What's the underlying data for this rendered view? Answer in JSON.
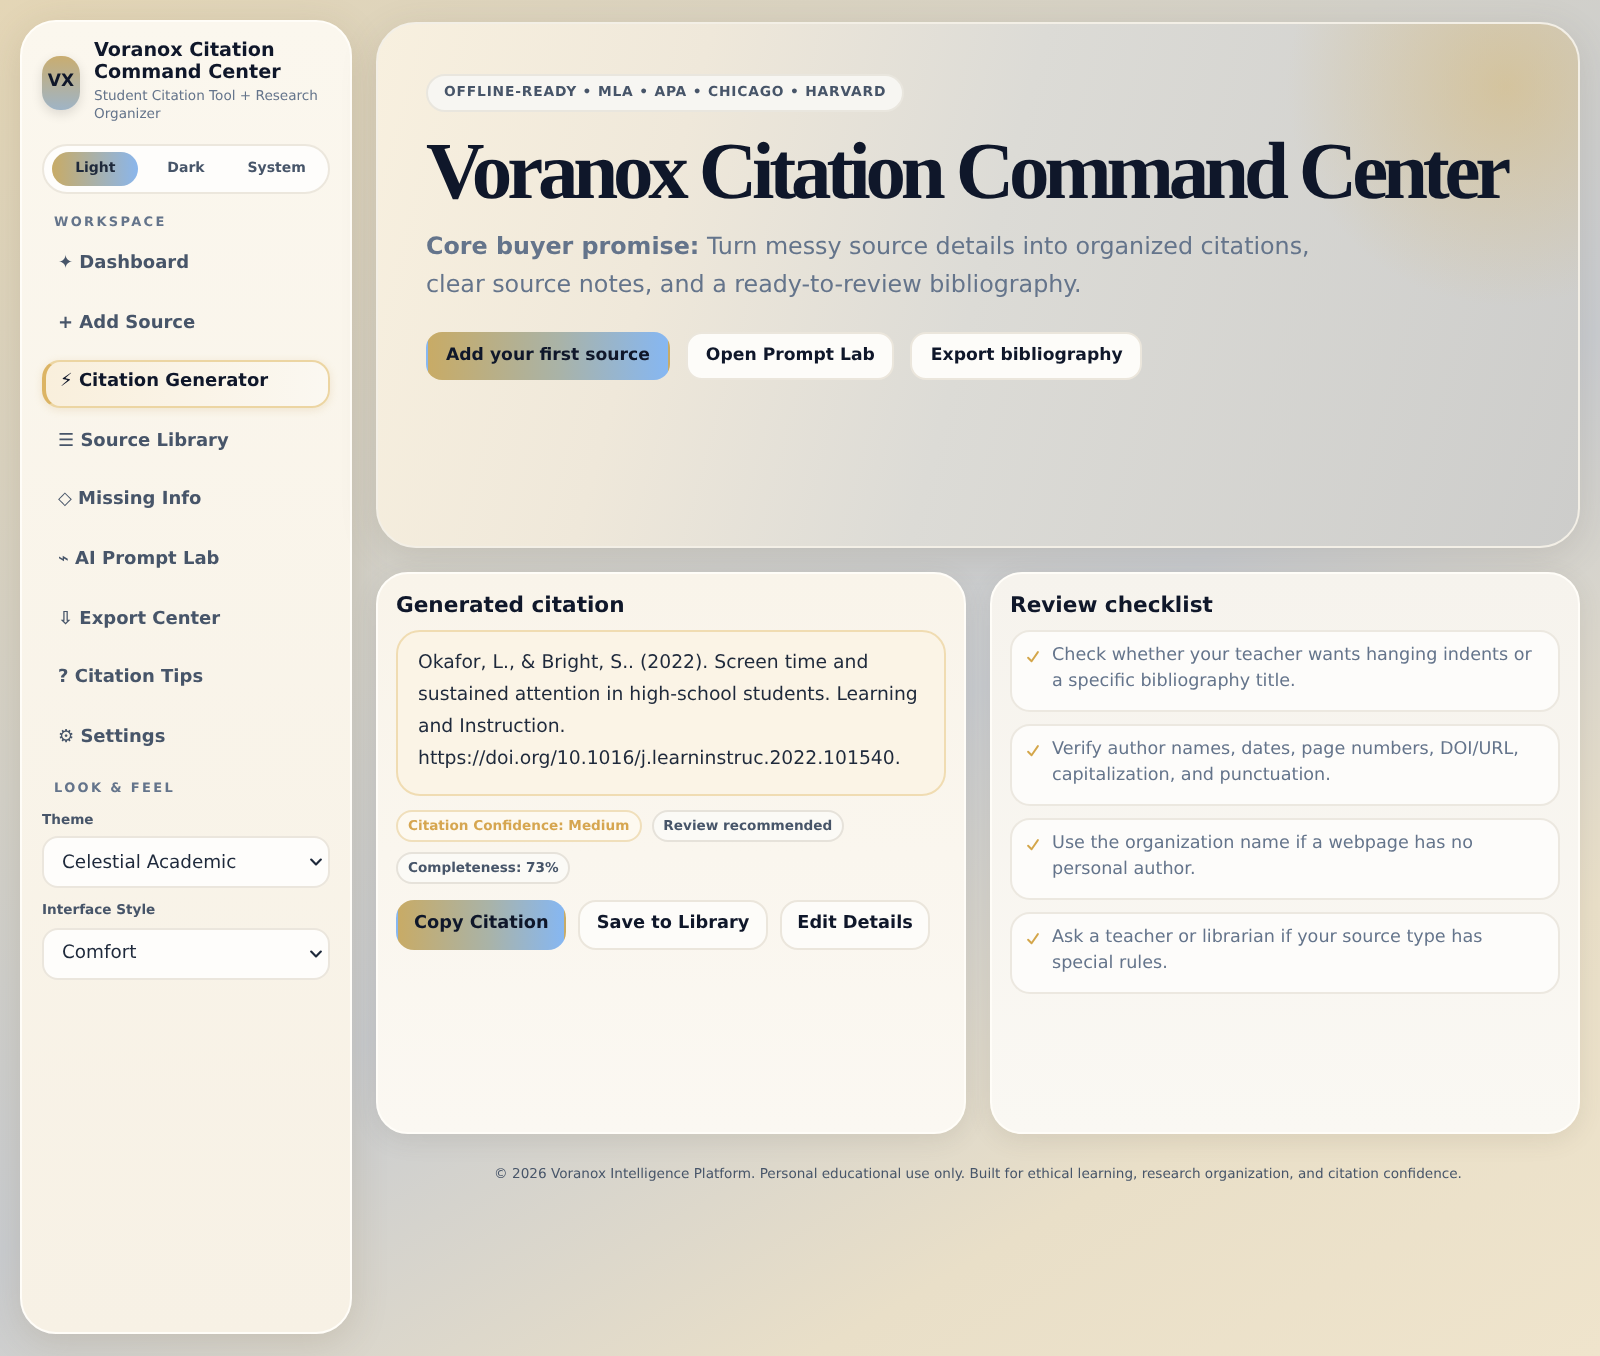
{
  "sidebar": {
    "logo": "VX",
    "title": "Voranox Citation Command Center",
    "subtitle": "Student Citation Tool + Research Organizer",
    "appearance": [
      {
        "label": "Light",
        "selected": true
      },
      {
        "label": "Dark",
        "selected": false
      },
      {
        "label": "System",
        "selected": false
      }
    ],
    "workspace_heading": "WORKSPACE",
    "items": [
      {
        "label": "✦ Dashboard",
        "selected": false
      },
      {
        "label": "+ Add Source",
        "selected": false
      },
      {
        "label": "⚡ Citation Generator",
        "selected": true
      },
      {
        "label": "☰ Source Library",
        "selected": false
      },
      {
        "label": "◇ Missing Info",
        "selected": false
      },
      {
        "label": "⌁ AI Prompt Lab",
        "selected": false
      },
      {
        "label": "⇩ Export Center",
        "selected": false
      },
      {
        "label": "? Citation Tips",
        "selected": false
      },
      {
        "label": "⚙ Settings",
        "selected": false
      }
    ],
    "look_heading": "LOOK & FEEL",
    "settings": [
      {
        "label": "Theme",
        "value": "Celestial Academic"
      },
      {
        "label": "Interface Style",
        "value": "Comfort"
      }
    ]
  },
  "hero": {
    "badge": "OFFLINE-READY • MLA • APA • CHICAGO • HARVARD",
    "title": "Voranox Citation Command Center",
    "promise": "**Core buyer promise:** Turn messy source details into organized citations, clear source notes, and a ready-to-review bibliography.",
    "buttons": [
      {
        "label": "Add your first source",
        "kind": "primary"
      },
      {
        "label": "Open Prompt Lab",
        "kind": "secondary"
      },
      {
        "label": "Export bibliography",
        "kind": "secondary"
      }
    ]
  },
  "citation_card": {
    "title": "Generated citation",
    "citation": "Okafor, L., & Bright, S.. (2022). Screen time and sustained attention in high-school students. Learning and Instruction. https://doi.org/10.1016/j.learninstruc.2022.101540.",
    "badges": [
      {
        "label": "Citation Confidence: Medium",
        "kind": "warning"
      },
      {
        "label": "Review recommended",
        "kind": "neutral"
      },
      {
        "label": "Completeness: 73%",
        "kind": "neutral"
      }
    ],
    "buttons": [
      {
        "label": "Copy Citation",
        "kind": "primary"
      },
      {
        "label": "Save to Library",
        "kind": "secondary"
      },
      {
        "label": "Edit Details",
        "kind": "secondary"
      }
    ]
  },
  "checklist": {
    "title": "Review checklist",
    "items": [
      "Check whether your teacher wants hanging indents or a specific bibliography title.",
      "Verify author names, dates, page numbers, DOI/URL, capitalization, and punctuation.",
      "Use the organization name if a webpage has no personal author.",
      "Ask a teacher or librarian if your source type has special rules."
    ]
  },
  "footer": "© 2026 Voranox Intelligence Platform. Personal educational use only. Built for ethical learning, research organization, and citation confidence."
}
